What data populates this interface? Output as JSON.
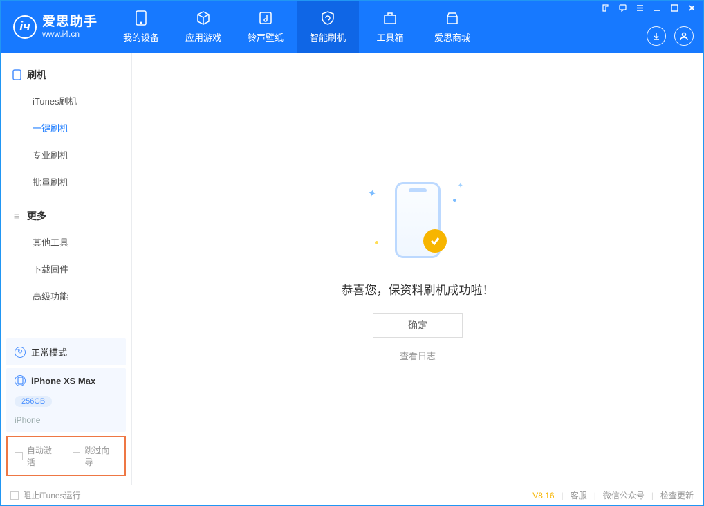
{
  "brand": {
    "title": "爱思助手",
    "subtitle": "www.i4.cn"
  },
  "tabs": [
    {
      "id": "device",
      "label": "我的设备"
    },
    {
      "id": "apps",
      "label": "应用游戏"
    },
    {
      "id": "ringtone",
      "label": "铃声壁纸"
    },
    {
      "id": "flash",
      "label": "智能刷机"
    },
    {
      "id": "toolbox",
      "label": "工具箱"
    },
    {
      "id": "mall",
      "label": "爱思商城"
    }
  ],
  "sidebar": {
    "group1": {
      "title": "刷机",
      "items": [
        "iTunes刷机",
        "一键刷机",
        "专业刷机",
        "批量刷机"
      ]
    },
    "group2": {
      "title": "更多",
      "items": [
        "其他工具",
        "下载固件",
        "高级功能"
      ]
    }
  },
  "mode_card": {
    "label": "正常模式"
  },
  "device_card": {
    "name": "iPhone XS Max",
    "capacity": "256GB",
    "type": "iPhone"
  },
  "options": {
    "auto_activate": "自动激活",
    "skip_guide": "跳过向导"
  },
  "main": {
    "success_text": "恭喜您，保资料刷机成功啦！",
    "ok_label": "确定",
    "log_link": "查看日志"
  },
  "footer": {
    "block_itunes": "阻止iTunes运行",
    "version": "V8.16",
    "links": [
      "客服",
      "微信公众号",
      "检查更新"
    ]
  }
}
